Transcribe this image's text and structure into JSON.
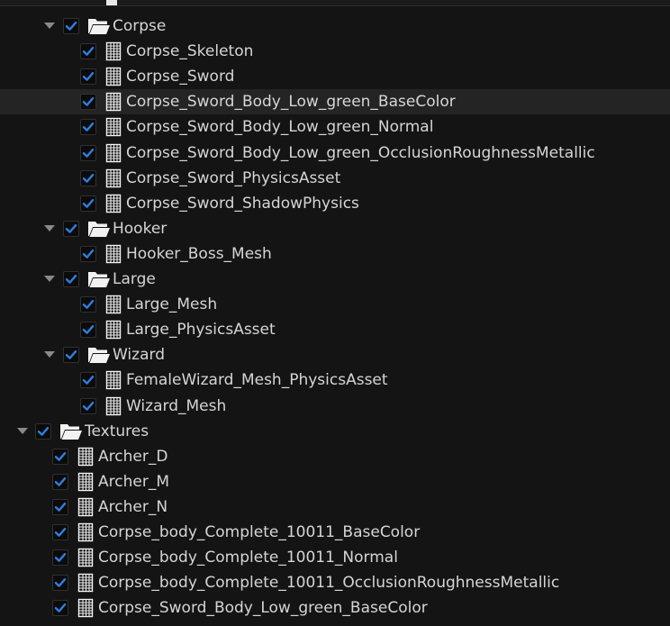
{
  "tree": {
    "rows": [
      {
        "label": "Corpse",
        "type": "folder",
        "level": 1,
        "checked": true,
        "expanded": true
      },
      {
        "label": "Corpse_Skeleton",
        "type": "file",
        "level": 2,
        "checked": true
      },
      {
        "label": "Corpse_Sword",
        "type": "file",
        "level": 2,
        "checked": true
      },
      {
        "label": "Corpse_Sword_Body_Low_green_BaseColor",
        "type": "file",
        "level": 2,
        "checked": true,
        "hovered": true
      },
      {
        "label": "Corpse_Sword_Body_Low_green_Normal",
        "type": "file",
        "level": 2,
        "checked": true
      },
      {
        "label": "Corpse_Sword_Body_Low_green_OcclusionRoughnessMetallic",
        "type": "file",
        "level": 2,
        "checked": true
      },
      {
        "label": "Corpse_Sword_PhysicsAsset",
        "type": "file",
        "level": 2,
        "checked": true
      },
      {
        "label": "Corpse_Sword_ShadowPhysics",
        "type": "file",
        "level": 2,
        "checked": true
      },
      {
        "label": "Hooker",
        "type": "folder",
        "level": 1,
        "checked": true,
        "expanded": true
      },
      {
        "label": "Hooker_Boss_Mesh",
        "type": "file",
        "level": 2,
        "checked": true
      },
      {
        "label": "Large",
        "type": "folder",
        "level": 1,
        "checked": true,
        "expanded": true
      },
      {
        "label": "Large_Mesh",
        "type": "file",
        "level": 2,
        "checked": true
      },
      {
        "label": "Large_PhysicsAsset",
        "type": "file",
        "level": 2,
        "checked": true
      },
      {
        "label": "Wizard",
        "type": "folder",
        "level": 1,
        "checked": true,
        "expanded": true
      },
      {
        "label": "FemaleWizard_Mesh_PhysicsAsset",
        "type": "file",
        "level": 2,
        "checked": true
      },
      {
        "label": "Wizard_Mesh",
        "type": "file",
        "level": 2,
        "checked": true
      },
      {
        "label": "Textures",
        "type": "folder",
        "level": 0,
        "checked": true,
        "expanded": true
      },
      {
        "label": "Archer_D",
        "type": "file",
        "level": 1,
        "checked": true
      },
      {
        "label": "Archer_M",
        "type": "file",
        "level": 1,
        "checked": true
      },
      {
        "label": "Archer_N",
        "type": "file",
        "level": 1,
        "checked": true
      },
      {
        "label": "Corpse_body_Complete_10011_BaseColor",
        "type": "file",
        "level": 1,
        "checked": true
      },
      {
        "label": "Corpse_body_Complete_10011_Normal",
        "type": "file",
        "level": 1,
        "checked": true
      },
      {
        "label": "Corpse_body_Complete_10011_OcclusionRoughnessMetallic",
        "type": "file",
        "level": 1,
        "checked": true
      },
      {
        "label": "Corpse_Sword_Body_Low_green_BaseColor",
        "type": "file",
        "level": 1,
        "checked": true
      }
    ]
  },
  "colors": {
    "checkmark": "#2f7fe0",
    "text": "#d5d5d5",
    "background": "#141414",
    "hover_row": "#242424",
    "icon_fill": "#f2f2f2"
  },
  "icons": {
    "expand": "triangle-down-icon",
    "folder": "folder-open-icon",
    "file": "document-icon",
    "check": "checkmark-icon"
  }
}
